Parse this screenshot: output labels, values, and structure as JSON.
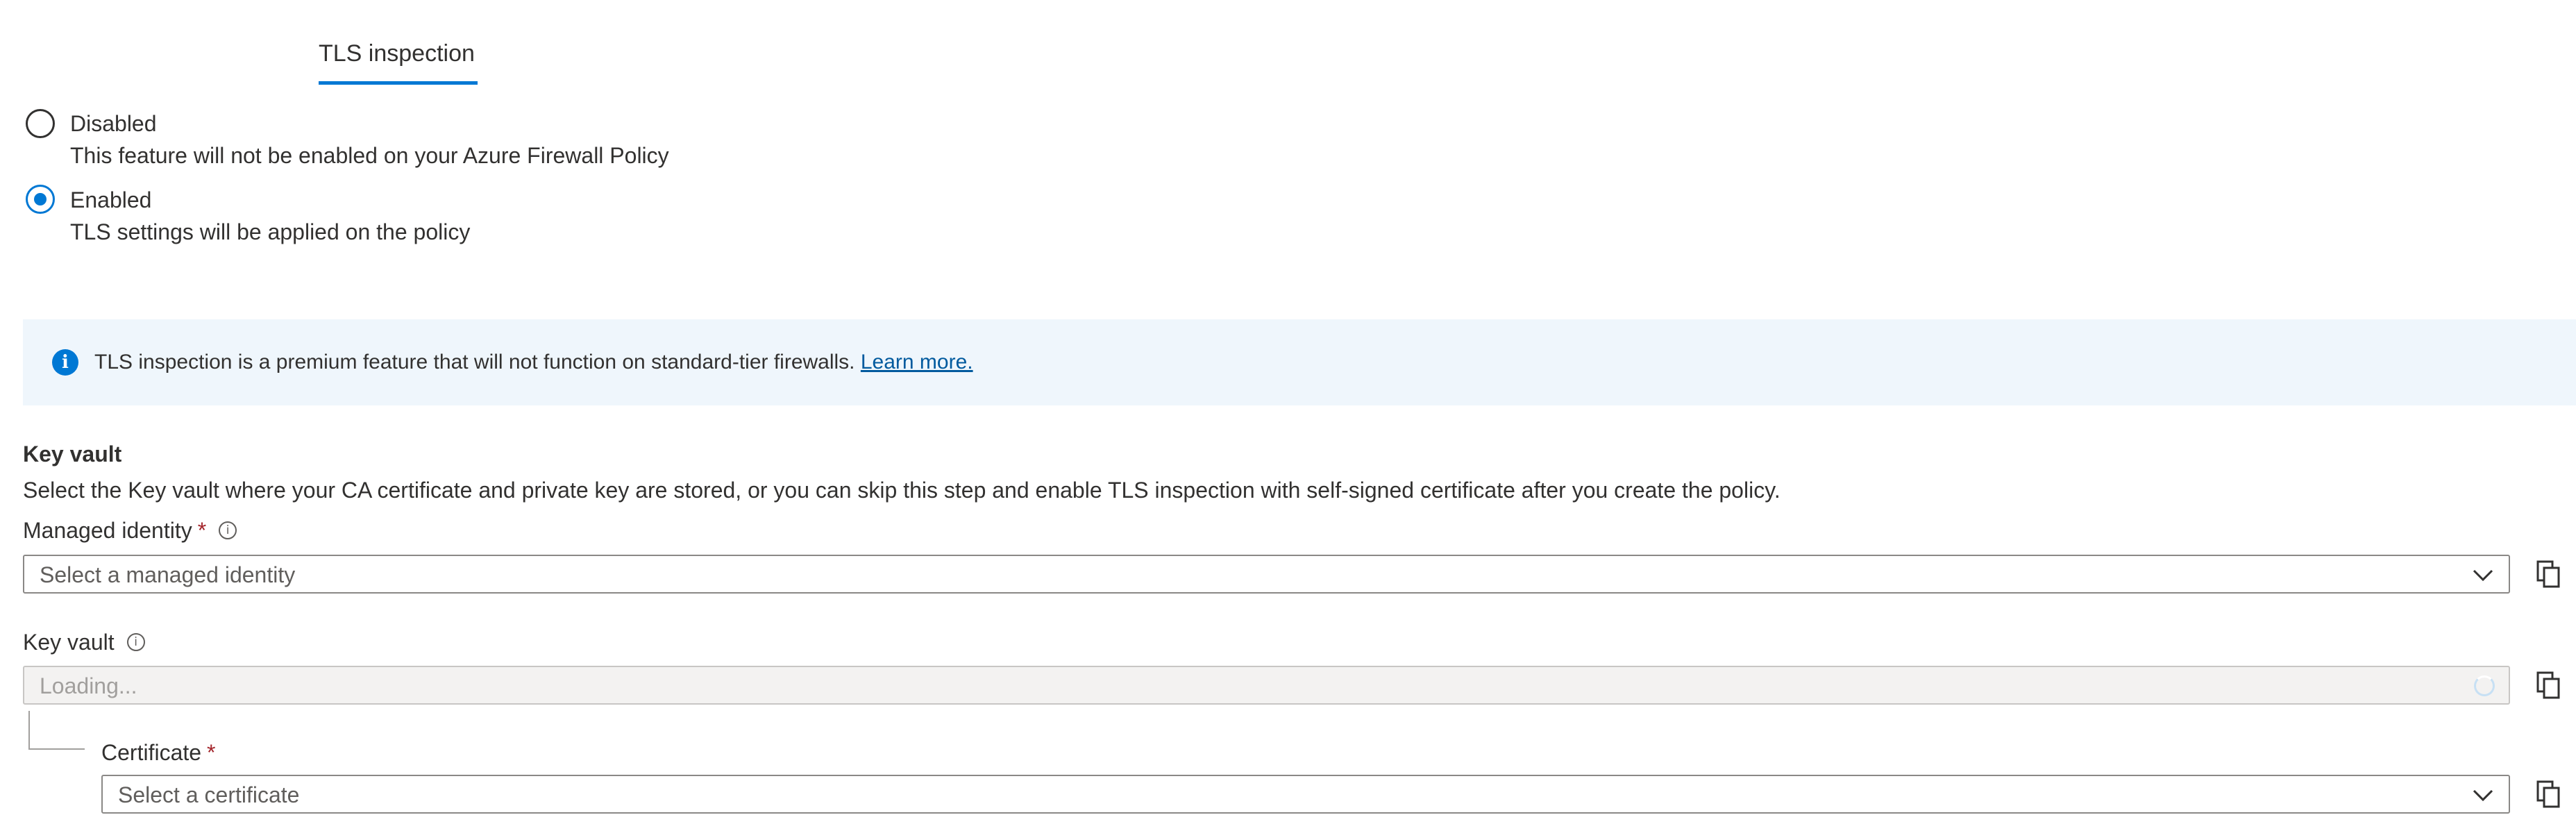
{
  "tab": {
    "label": "TLS inspection"
  },
  "radio_options": [
    {
      "title": "Disabled",
      "description": "This feature will not be enabled on your Azure Firewall Policy",
      "selected": false
    },
    {
      "title": "Enabled",
      "description": "TLS settings will be applied on the policy",
      "selected": true
    }
  ],
  "info_bar": {
    "icon": "info-icon",
    "text": "TLS inspection is a premium feature that will not function on standard-tier firewalls.",
    "link_text": "Learn more."
  },
  "key_vault_section": {
    "title": "Key vault",
    "description": "Select the Key vault where your CA certificate and private key are stored, or you can skip this step and enable TLS inspection with self-signed certificate after you create the policy."
  },
  "fields": {
    "managed_identity": {
      "label": "Managed identity",
      "required_mark": "*",
      "placeholder": "Select a managed identity"
    },
    "key_vault": {
      "label": "Key vault",
      "placeholder": "Loading..."
    },
    "certificate": {
      "label": "Certificate",
      "required_mark": "*",
      "placeholder": "Select a certificate"
    }
  },
  "colors": {
    "accent": "#0078d4",
    "info_bg": "#eff6fc",
    "required": "#a4262c"
  }
}
